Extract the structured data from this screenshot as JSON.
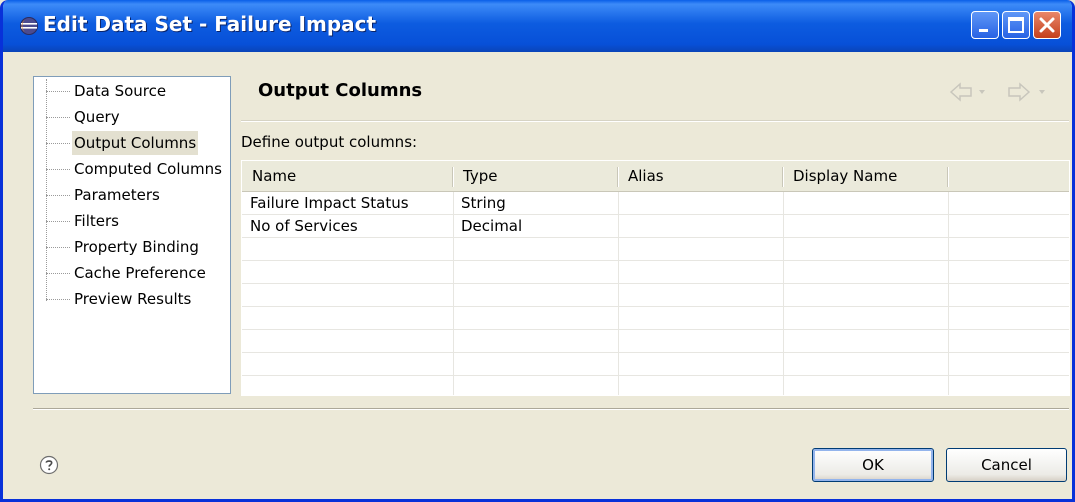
{
  "window": {
    "title": "Edit Data Set - Failure Impact"
  },
  "nav": {
    "items": [
      {
        "label": "Data Source"
      },
      {
        "label": "Query"
      },
      {
        "label": "Output Columns"
      },
      {
        "label": "Computed Columns"
      },
      {
        "label": "Parameters"
      },
      {
        "label": "Filters"
      },
      {
        "label": "Property Binding"
      },
      {
        "label": "Cache Preference"
      },
      {
        "label": "Preview Results"
      }
    ],
    "selected": "Output Columns"
  },
  "page": {
    "title": "Output Columns",
    "define_label": "Define output columns:"
  },
  "grid": {
    "columns": [
      "Name",
      "Type",
      "Alias",
      "Display Name"
    ],
    "rows": [
      {
        "name": "Failure Impact Status",
        "type": "String",
        "alias": "",
        "display_name": ""
      },
      {
        "name": "No of Services",
        "type": "Decimal",
        "alias": "",
        "display_name": ""
      }
    ]
  },
  "buttons": {
    "ok": "OK",
    "cancel": "Cancel"
  },
  "icons": {
    "app": "eclipse-icon",
    "help": "help-icon",
    "back": "back-arrow-icon",
    "forward": "forward-arrow-icon"
  },
  "colors": {
    "titlebar": "#0a5fe8",
    "window_bg": "#ece9d8",
    "close_button": "#c4401c"
  }
}
